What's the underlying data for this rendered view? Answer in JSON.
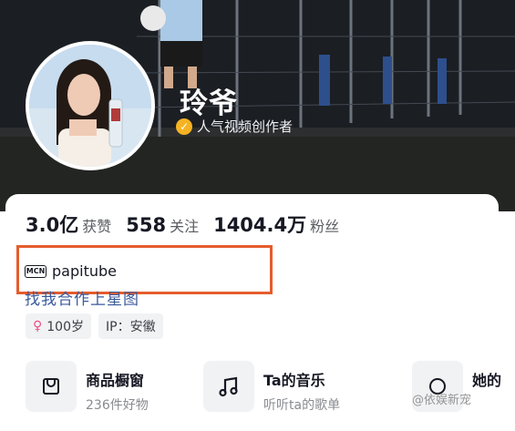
{
  "profile": {
    "nickname": "玲爷",
    "verification": "人气视频创作者"
  },
  "stats": [
    {
      "value": "3.0亿",
      "label": "获赞"
    },
    {
      "value": "558",
      "label": "关注"
    },
    {
      "value": "1404.4万",
      "label": "粉丝"
    }
  ],
  "mcn": {
    "icon_text": "MCN",
    "name": "papitube"
  },
  "collab_link": "找我合作上星图",
  "tags": [
    {
      "icon": "female-icon",
      "text": "100岁"
    },
    {
      "text": "IP：安徽"
    }
  ],
  "entries": [
    {
      "icon": "shopping-bag-icon",
      "title": "商品橱窗",
      "subtitle": "236件好物"
    },
    {
      "icon": "music-note-icon",
      "title": "Ta的音乐",
      "subtitle": "听听ta的歌单"
    },
    {
      "icon": "partial-icon",
      "title": "她的"
    }
  ],
  "watermark": "@依娱新宠",
  "colors": {
    "highlight_box": "#e55c2d",
    "verify_badge": "#f5b323",
    "link": "#3b5a9c"
  }
}
